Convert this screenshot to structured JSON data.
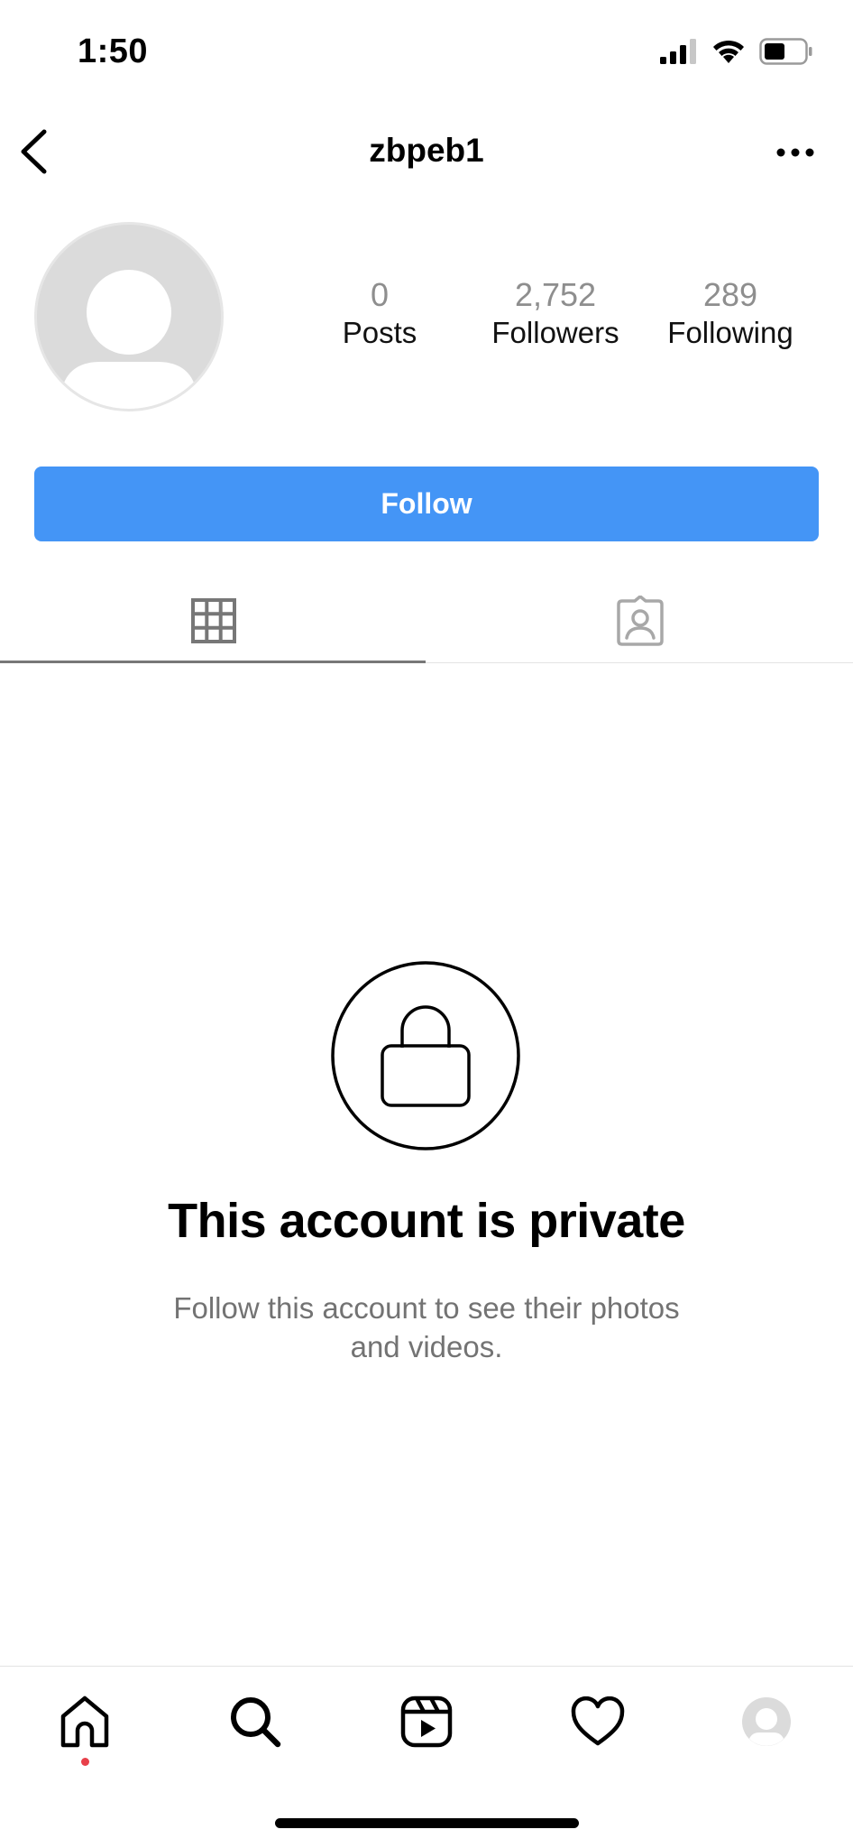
{
  "status_bar": {
    "time": "1:50",
    "icons": [
      "signal-icon",
      "wifi-icon",
      "battery-icon"
    ]
  },
  "header": {
    "username": "zbpeb1",
    "back_icon": "chevron-left-icon",
    "more_icon": "ellipsis-icon"
  },
  "profile": {
    "avatar_icon": "default-avatar-icon",
    "stats": [
      {
        "value": "0",
        "label": "Posts"
      },
      {
        "value": "2,752",
        "label": "Followers"
      },
      {
        "value": "289",
        "label": "Following"
      }
    ]
  },
  "follow_button": {
    "label": "Follow",
    "color": "#4495f6"
  },
  "tabs": [
    {
      "icon": "grid-icon",
      "active": true
    },
    {
      "icon": "tagged-icon",
      "active": false
    }
  ],
  "private_notice": {
    "icon": "lock-icon",
    "title": "This account is private",
    "subtitle_line1": "Follow this account to see their photos",
    "subtitle_line2": "and videos."
  },
  "bottom_nav": {
    "items": [
      "home-icon",
      "search-icon",
      "reels-icon",
      "heart-icon",
      "profile-avatar-icon"
    ],
    "notification_dot_color": "#e8404a"
  }
}
